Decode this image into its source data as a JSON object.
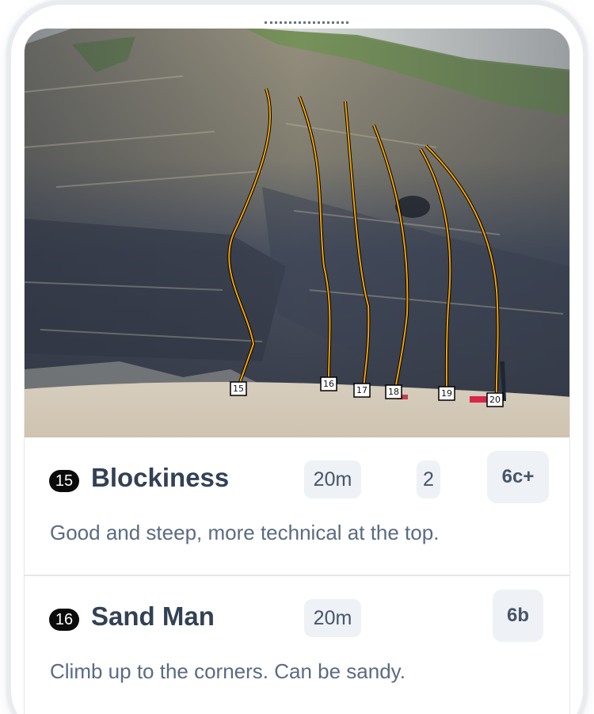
{
  "topo": {
    "markers": [
      "15",
      "16",
      "17",
      "18",
      "19",
      "20"
    ],
    "line_color": "#f5a300"
  },
  "routes": [
    {
      "number": "15",
      "name": "Blockiness",
      "length": "20m",
      "pitches": "2",
      "grade": "6c+",
      "description": "Good and steep, more technical at the top."
    },
    {
      "number": "16",
      "name": "Sand Man",
      "length": "20m",
      "grade": "6b",
      "description": "Climb up to the corners. Can be sandy."
    }
  ]
}
